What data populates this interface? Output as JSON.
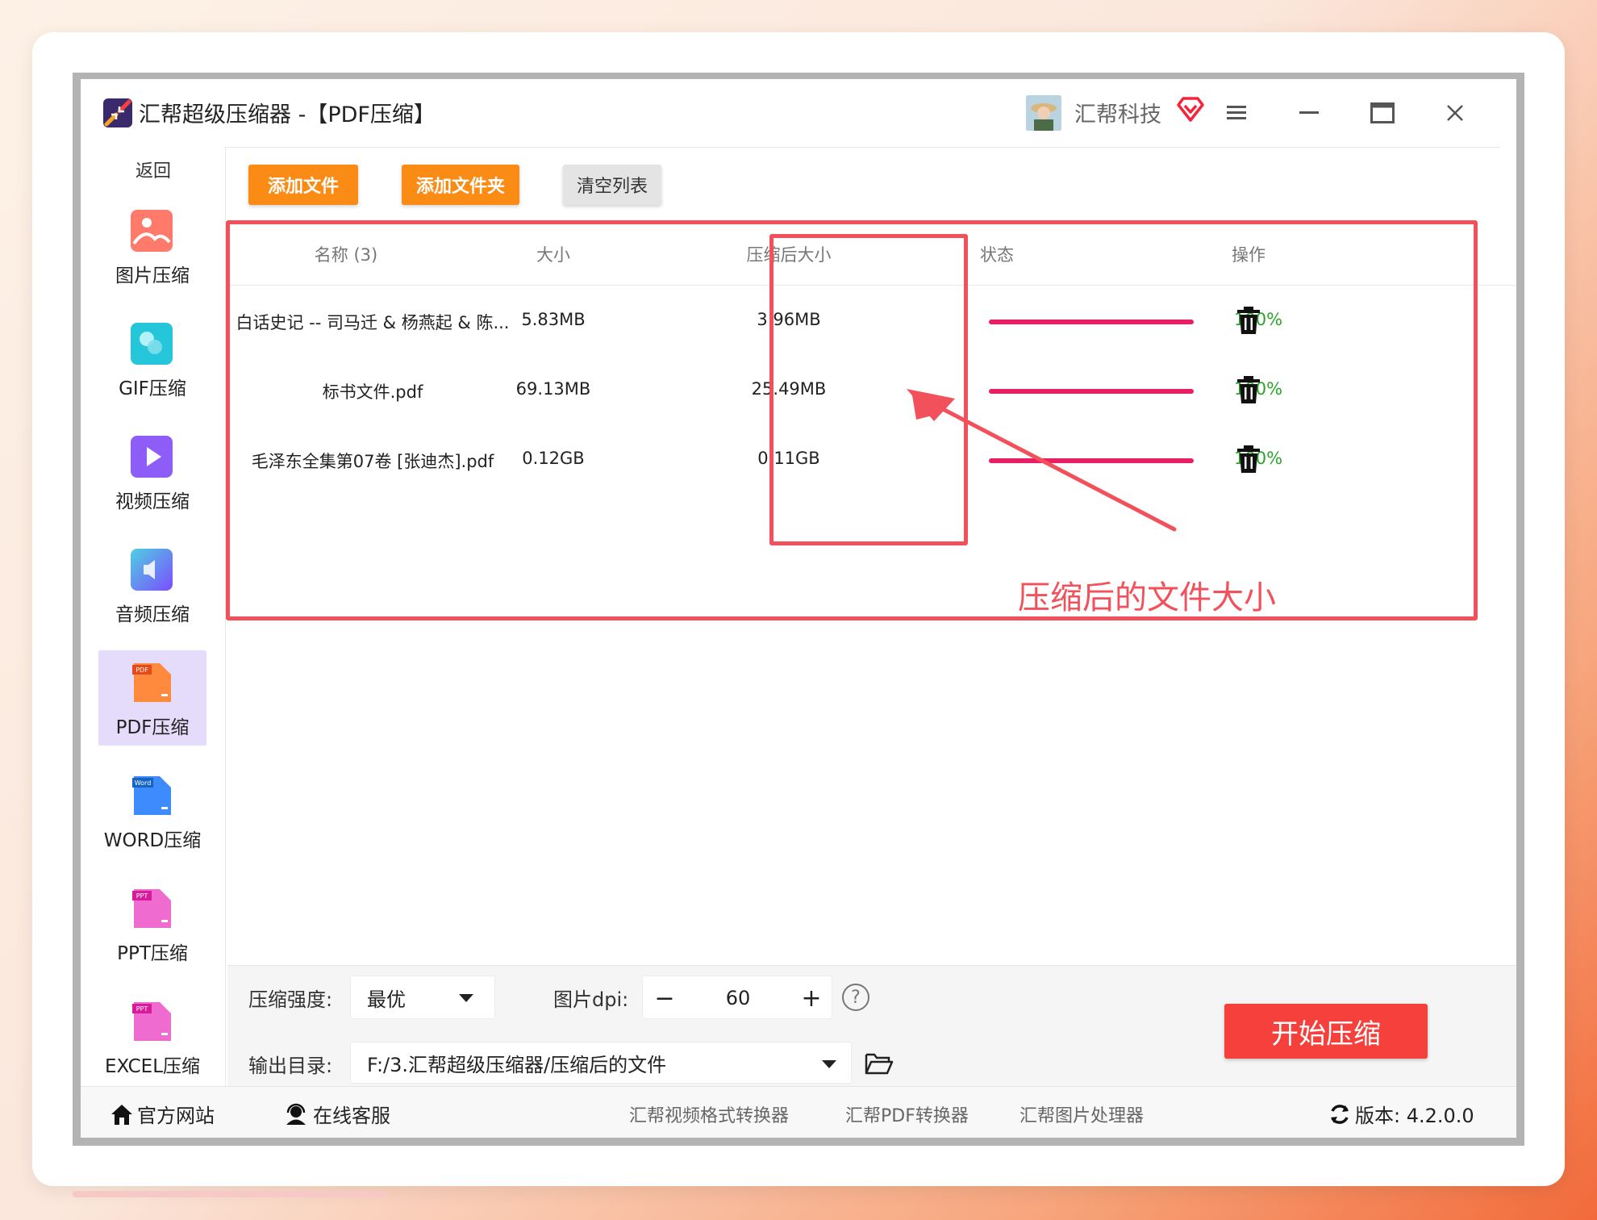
{
  "app": {
    "title": "汇帮超级压缩器  -【PDF压缩】",
    "user_name": "汇帮科技"
  },
  "sidebar": {
    "back_label": "返回",
    "items": [
      {
        "label": "图片压缩",
        "icon": "image-icon"
      },
      {
        "label": "GIF压缩",
        "icon": "gif-icon"
      },
      {
        "label": "视频压缩",
        "icon": "video-icon"
      },
      {
        "label": "音频压缩",
        "icon": "audio-icon"
      },
      {
        "label": "PDF压缩",
        "icon": "pdf-icon",
        "active": true
      },
      {
        "label": "WORD压缩",
        "icon": "word-icon"
      },
      {
        "label": "PPT压缩",
        "icon": "ppt-icon"
      },
      {
        "label": "EXCEL压缩",
        "icon": "excel-icon"
      }
    ]
  },
  "toolbar": {
    "add_file": "添加文件",
    "add_folder": "添加文件夹",
    "clear_list": "清空列表"
  },
  "table": {
    "headers": {
      "name": "名称 (3)",
      "size": "大小",
      "compressed_size": "压缩后大小",
      "status": "状态",
      "action": "操作"
    },
    "rows": [
      {
        "name": "白话史记 -- 司马迁 & 杨燕起 & 陈...",
        "size": "5.83MB",
        "compressed": "3.96MB",
        "progress": 1.0,
        "percent": "100%"
      },
      {
        "name": "标书文件.pdf",
        "size": "69.13MB",
        "compressed": "25.49MB",
        "progress": 1.0,
        "percent": "100%"
      },
      {
        "name": "毛泽东全集第07卷 [张迪杰].pdf",
        "size": "0.12GB",
        "compressed": "0.11GB",
        "progress": 1.0,
        "percent": "100%"
      }
    ]
  },
  "annotation": {
    "text": "压缩后的文件大小",
    "color": "#f2505a"
  },
  "settings": {
    "strength_label": "压缩强度:",
    "strength_value": "最优",
    "dpi_label": "图片dpi:",
    "dpi_value": "60",
    "minus": "−",
    "plus": "+",
    "help": "?",
    "output_label": "输出目录:",
    "output_path": "F:/3.汇帮超级压缩器/压缩后的文件"
  },
  "start_button": "开始压缩",
  "footer": {
    "official_site": "官方网站",
    "online_service": "在线客服",
    "link_video": "汇帮视频格式转换器",
    "link_pdf": "汇帮PDF转换器",
    "link_image": "汇帮图片处理器",
    "version": "版本: 4.2.0.0"
  },
  "colors": {
    "accent_orange": "#fa8c16",
    "progress": "#e91e63",
    "success": "#2aa52a",
    "start": "#f5403c",
    "active_nav": "#e5dcfb"
  }
}
